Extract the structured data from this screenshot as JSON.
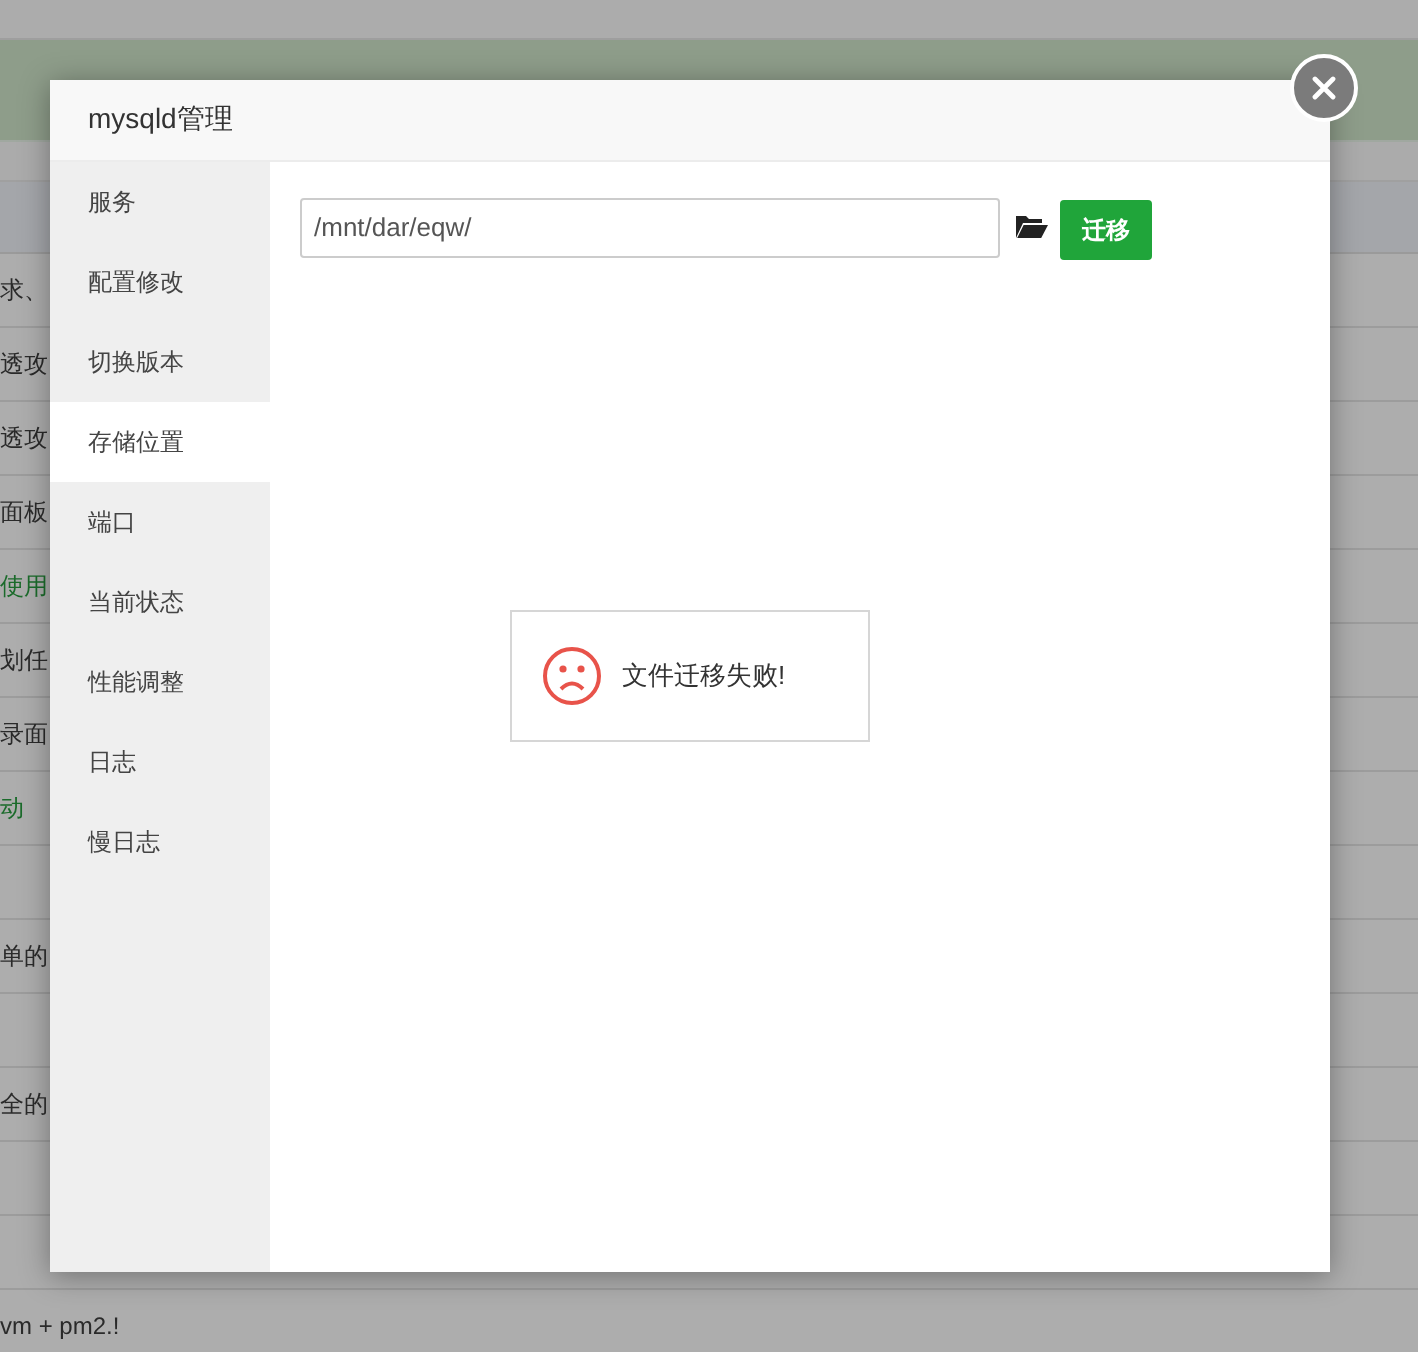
{
  "background": {
    "rows": [
      {
        "text": "求、",
        "kind": "plain"
      },
      {
        "text": "透攻",
        "kind": "plain"
      },
      {
        "text": "透攻",
        "kind": "plain"
      },
      {
        "text": "面板",
        "kind": "plain"
      },
      {
        "text": "使用",
        "kind": "link"
      },
      {
        "text": "划任",
        "kind": "plain"
      },
      {
        "text": "录面",
        "kind": "plain"
      },
      {
        "text": "动",
        "kind": "link"
      },
      {
        "kind": "plain"
      },
      {
        "text": "单的",
        "kind": "plain"
      },
      {
        "kind": "plain"
      },
      {
        "text": "全的",
        "kind": "plain"
      },
      {
        "kind": "plain"
      },
      {
        "kind": "plain"
      },
      {
        "text": "vm + pm2.!",
        "kind": "plain"
      }
    ]
  },
  "dialog": {
    "title": "mysqld管理",
    "sidebar": {
      "items": [
        {
          "label": "服务",
          "selected": false
        },
        {
          "label": "配置修改",
          "selected": false
        },
        {
          "label": "切换版本",
          "selected": false
        },
        {
          "label": "存储位置",
          "selected": true
        },
        {
          "label": "端口",
          "selected": false
        },
        {
          "label": "当前状态",
          "selected": false
        },
        {
          "label": "性能调整",
          "selected": false
        },
        {
          "label": "日志",
          "selected": false
        },
        {
          "label": "慢日志",
          "selected": false
        }
      ]
    },
    "path_field": {
      "value": "/mnt/dar/eqw/"
    },
    "move_button": "迁移",
    "message": {
      "kind": "error",
      "text": "文件迁移失败!"
    }
  }
}
